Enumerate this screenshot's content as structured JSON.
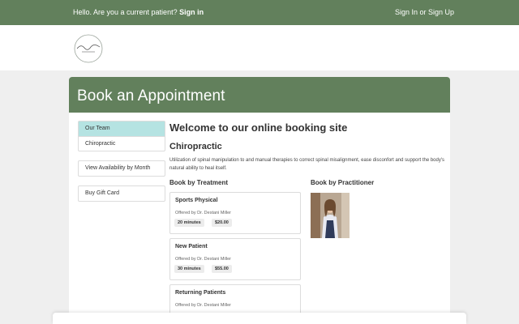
{
  "topbar": {
    "greeting": "Hello. Are you a current patient?",
    "sign_in_link": "Sign in",
    "auth_link": "Sign In or Sign Up"
  },
  "panel": {
    "title": "Book an Appointment"
  },
  "sidebar": {
    "categories": [
      {
        "label": "Our Team",
        "active": true
      },
      {
        "label": "Chiropractic",
        "active": false
      }
    ],
    "view_availability": "View Availability by Month",
    "gift_card": "Buy Gift Card"
  },
  "main": {
    "welcome": "Welcome to our online booking site",
    "category_title": "Chiropractic",
    "category_description": "Utilization of spinal manipulation to and manual therapies to correct spinal misalignment, ease disconfort and support the body's natural ability to heal itself.",
    "book_by_treatment": "Book by Treatment",
    "book_by_practitioner": "Book by Practitioner",
    "treatments": [
      {
        "name": "Sports Physical",
        "offered_by": "Offered by Dr. Destani Miller",
        "duration": "20 minutes",
        "price": "$20.00"
      },
      {
        "name": "New Patient",
        "offered_by": "Offered by Dr. Destani Miller",
        "duration": "30 minutes",
        "price": "$55.00"
      },
      {
        "name": "Returning Patients",
        "offered_by": "Offered by Dr. Destani Miller"
      }
    ]
  },
  "colors": {
    "brand_green": "#62805c",
    "active_tab": "#b5e3e2",
    "page_bg": "#efefef"
  }
}
